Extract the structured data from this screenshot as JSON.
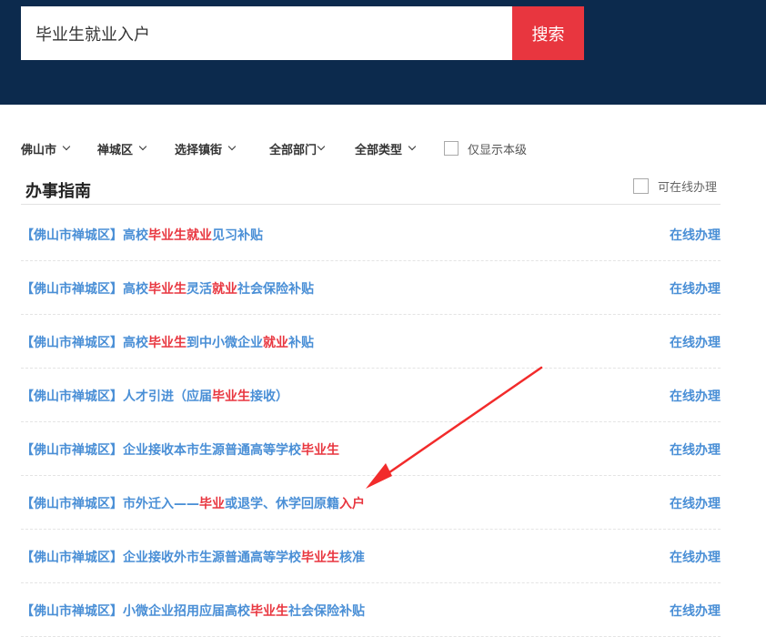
{
  "search": {
    "value": "毕业生就业入户",
    "button_label": "搜索"
  },
  "filters": {
    "city": "佛山市",
    "district": "禅城区",
    "town": "选择镇街",
    "department": "全部部门",
    "type": "全部类型",
    "only_this_level": "仅显示本级"
  },
  "section": {
    "title": "办事指南",
    "online_filter_label": "可在线办理"
  },
  "items": [
    {
      "segments": [
        [
          "【佛山市禅城区】高校",
          false
        ],
        [
          "毕业生就业",
          true
        ],
        [
          "见习补贴",
          false
        ]
      ],
      "action": "在线办理"
    },
    {
      "segments": [
        [
          "【佛山市禅城区】高校",
          false
        ],
        [
          "毕业生",
          true
        ],
        [
          "灵活",
          false
        ],
        [
          "就业",
          true
        ],
        [
          "社会保险补贴",
          false
        ]
      ],
      "action": "在线办理"
    },
    {
      "segments": [
        [
          "【佛山市禅城区】高校",
          false
        ],
        [
          "毕业生",
          true
        ],
        [
          "到中小微企业",
          false
        ],
        [
          "就业",
          true
        ],
        [
          "补贴",
          false
        ]
      ],
      "action": "在线办理"
    },
    {
      "segments": [
        [
          "【佛山市禅城区】人才引进（应届",
          false
        ],
        [
          "毕业生",
          true
        ],
        [
          "接收）",
          false
        ]
      ],
      "action": "在线办理"
    },
    {
      "segments": [
        [
          "【佛山市禅城区】企业接收本市生源普通高等学校",
          false
        ],
        [
          "毕业生",
          true
        ]
      ],
      "action": "在线办理"
    },
    {
      "segments": [
        [
          "【佛山市禅城区】市外迁入——",
          false
        ],
        [
          "毕业",
          true
        ],
        [
          "或退学、休学回原籍",
          false
        ],
        [
          "入户",
          true
        ]
      ],
      "action": "在线办理"
    },
    {
      "segments": [
        [
          "【佛山市禅城区】企业接收外市生源普通高等学校",
          false
        ],
        [
          "毕业生",
          true
        ],
        [
          "核准",
          false
        ]
      ],
      "action": "在线办理"
    },
    {
      "segments": [
        [
          "【佛山市禅城区】小微企业招用应届高校",
          false
        ],
        [
          "毕业生",
          true
        ],
        [
          "社会保险补贴",
          false
        ]
      ],
      "action": "在线办理"
    }
  ],
  "colors": {
    "header_bg": "#0c2a4d",
    "accent_red": "#e8363f",
    "link_blue": "#4a8fd6"
  }
}
